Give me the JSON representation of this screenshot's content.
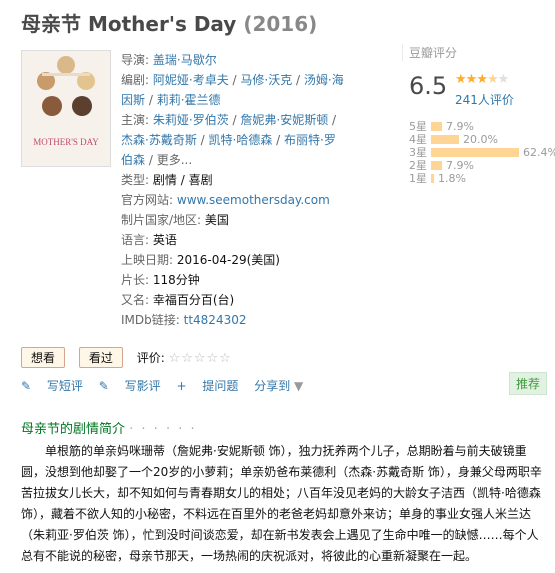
{
  "title": "母亲节 Mother's Day",
  "year": "(2016)",
  "poster": {
    "title": "MOTHER'S DAY"
  },
  "info": {
    "director_label": "导演:",
    "directors": [
      "盖瑞·马歇尔"
    ],
    "writer_label": "编剧:",
    "writers": [
      "阿妮娅·考卓夫",
      "马修·沃克",
      "汤姆·海因斯",
      "莉莉·霍兰德"
    ],
    "cast_label": "主演:",
    "cast": [
      "朱莉娅·罗伯茨",
      "詹妮弗·安妮斯顿",
      "杰森·苏戴奇斯",
      "凯特·哈德森",
      "布丽特·罗伯森"
    ],
    "more": "更多...",
    "genre_label": "类型:",
    "genres": [
      "剧情",
      "喜剧"
    ],
    "site_label": "官方网站:",
    "site": "www.seemothersday.com",
    "country_label": "制片国家/地区:",
    "country": "美国",
    "lang_label": "语言:",
    "lang": "英语",
    "release_label": "上映日期:",
    "release": "2016-04-29(美国)",
    "runtime_label": "片长:",
    "runtime": "118分钟",
    "aka_label": "又名:",
    "aka": "幸福百分百(台)",
    "imdb_label": "IMDb链接:",
    "imdb": "tt4824302"
  },
  "rating": {
    "label": "豆瓣评分",
    "score": "6.5",
    "stars_value": 3.5,
    "votes": "241人评价",
    "distribution": [
      {
        "label": "5星",
        "pct": "7.9%",
        "value": 7.9
      },
      {
        "label": "4星",
        "pct": "20.0%",
        "value": 20.0
      },
      {
        "label": "3星",
        "pct": "62.4%",
        "value": 62.4
      },
      {
        "label": "2星",
        "pct": "7.9%",
        "value": 7.9
      },
      {
        "label": "1星",
        "pct": "1.8%",
        "value": 1.8
      }
    ]
  },
  "buttons": {
    "want": "想看",
    "seen": "看过",
    "rate_label": "评价:",
    "rate_stars": "☆☆☆☆☆"
  },
  "actions": {
    "short_review": "写短评",
    "review": "写影评",
    "question": "提问题",
    "share": "分享到"
  },
  "recommend": "推荐",
  "summary": {
    "title": "母亲节的剧情简介",
    "dots": "· · · · · ·",
    "text": "单根筋的单亲妈咪珊蒂（詹妮弗·安妮斯顿 饰），独力抚养两个儿子，总期盼着与前夫破镜重圆，没想到他却娶了一个20岁的小萝莉；单亲奶爸布莱德利（杰森·苏戴奇斯 饰），身兼父母两职辛苦拉拔女儿长大，却不知如何与青春期女儿的相处；八百年没见老妈的大龄女子洁西（凯特·哈德森 饰），藏着不欲人知的小秘密，不料远在百里外的老爸老妈却意外来访；单身的事业女强人米兰达（朱莉亚·罗伯茨 饰），忙到没时间谈恋爱，却在新书发表会上遇见了生命中唯一的缺憾……每个人总有不能说的秘密，母亲节那天，一场热闹的庆祝派对，将彼此的心重新凝聚在一起。"
  },
  "colors": {
    "link": "#3377aa",
    "bar": "#ffd596",
    "green": "#007722"
  }
}
